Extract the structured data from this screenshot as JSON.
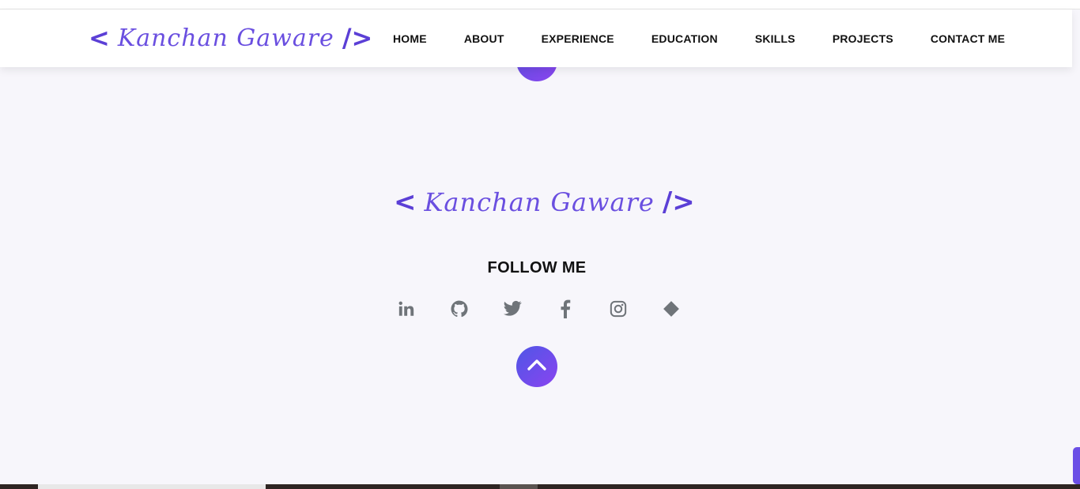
{
  "header": {
    "logo": {
      "open_bracket": "<",
      "name": "Kanchan Gaware",
      "close_bracket": "/>"
    },
    "nav": [
      {
        "label": "HOME"
      },
      {
        "label": "ABOUT"
      },
      {
        "label": "EXPERIENCE"
      },
      {
        "label": "EDUCATION"
      },
      {
        "label": "SKILLS"
      },
      {
        "label": "PROJECTS"
      },
      {
        "label": "CONTACT ME"
      }
    ]
  },
  "footer": {
    "logo": {
      "open_bracket": "<",
      "name": "Kanchan Gaware",
      "close_bracket": "/>"
    },
    "follow_heading": "FOLLOW ME",
    "social_icons": [
      "linkedin-icon",
      "github-icon",
      "twitter-icon",
      "facebook-icon",
      "instagram-icon",
      "diamond-icon"
    ],
    "back_to_top_icon": "chevron-up-icon"
  },
  "colors": {
    "brand": "#5b3fd6",
    "gradient_start": "#4f56e6",
    "gradient_end": "#8a44f0",
    "icon_gray": "#6f7479",
    "background": "#f7f6fb"
  }
}
